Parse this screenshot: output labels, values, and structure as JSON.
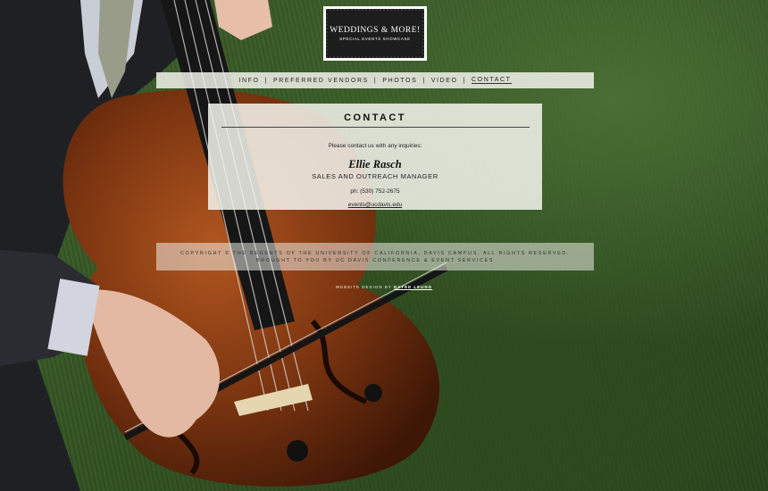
{
  "logo": {
    "title": "WEDDINGS & MORE!",
    "subtitle": "SPECIAL EVENTS SHOWCASE"
  },
  "nav": {
    "items": [
      {
        "label": "INFO"
      },
      {
        "label": "PREFERRED VENDORS"
      },
      {
        "label": "PHOTOS"
      },
      {
        "label": "VIDEO"
      },
      {
        "label": "CONTACT",
        "active": true
      }
    ],
    "separator": "|"
  },
  "contact": {
    "heading": "CONTACT",
    "intro": "Please contact us with any inquiries:",
    "name": "Ellie Rasch",
    "role": "SALES AND OUTREACH MANAGER",
    "phone": "ph: (530) 752-2675",
    "email": "events@ucdavis.edu"
  },
  "footer": {
    "copyright": "COPYRIGHT © THE REGENTS OF THE UNIVERSITY OF CALIFORNIA, DAVIS CAMPUS. ALL RIGHTS RESERVED.",
    "brought_by": "BROUGHT TO YOU BY UC DAVIS CONFERENCE & EVENT SERVICES",
    "credit_prefix": "WEBSITE DESIGN BY",
    "credit_name": "DAYEE LEUNG"
  },
  "colors": {
    "panel_bg": "#f4f4ee",
    "text": "#222222",
    "grass": "#3e5e2b",
    "cello": "#7a3410"
  }
}
